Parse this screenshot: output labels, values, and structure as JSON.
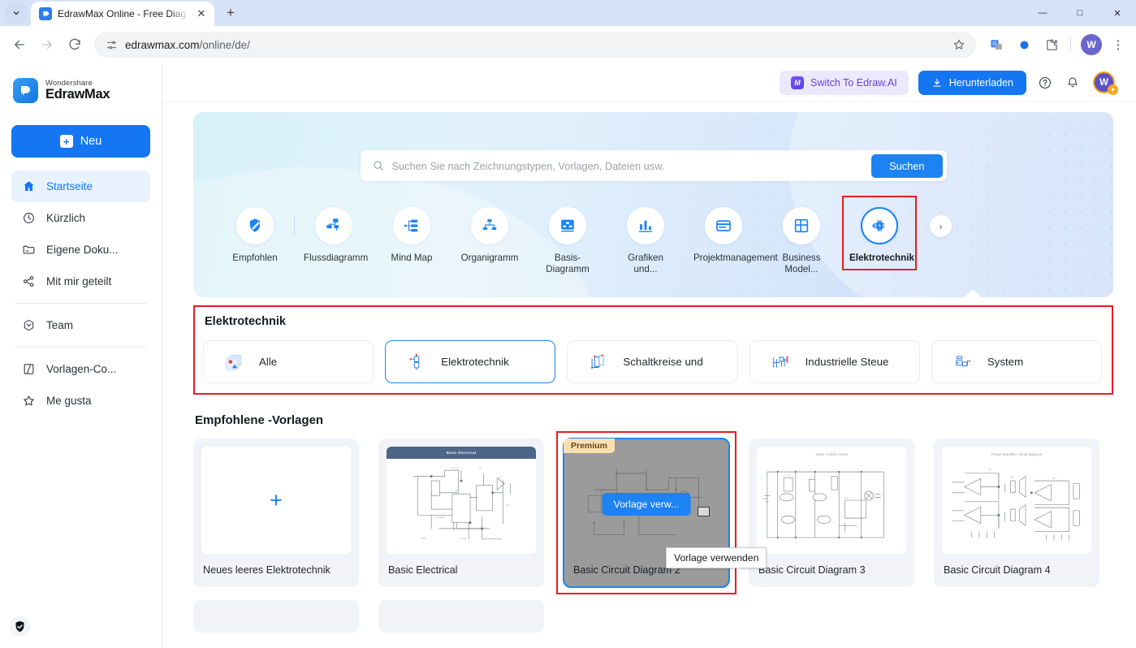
{
  "browser": {
    "tab_title": "EdrawMax Online - Free Diag",
    "new_tab_label": "+",
    "url_main": "edrawmax.com",
    "url_path": "/online/de/",
    "profile_initial": "W",
    "win_minimize": "—",
    "win_maximize": "□",
    "win_close": "✕"
  },
  "sidebar": {
    "brand_top": "Wondershare",
    "brand_bottom": "EdrawMax",
    "new_button": "Neu",
    "items": [
      {
        "label": "Startseite",
        "icon": "home-icon",
        "active": true
      },
      {
        "label": "Kürzlich",
        "icon": "clock-icon",
        "active": false
      },
      {
        "label": "Eigene Doku...",
        "icon": "folder-icon",
        "active": false
      },
      {
        "label": "Mit mir geteilt",
        "icon": "share-icon",
        "active": false
      },
      {
        "label": "Team",
        "icon": "team-icon",
        "active": false
      },
      {
        "label": "Vorlagen-Co...",
        "icon": "template-icon",
        "active": false
      },
      {
        "label": "Me gusta",
        "icon": "star-icon",
        "active": false
      }
    ]
  },
  "topbar": {
    "switch_ai": "Switch To Edraw.AI",
    "download": "Herunterladen",
    "help_icon": "question-circle-icon",
    "bell_icon": "bell-icon",
    "avatar_initial": "W"
  },
  "hero": {
    "search_placeholder": "Suchen Sie nach Zeichnungstypen, Vorlagen, Dateien usw.",
    "search_value": "",
    "search_button": "Suchen",
    "next_arrow": "›",
    "categories": [
      {
        "label": "Empfohlen",
        "icon": "recommended-icon",
        "active": false
      },
      {
        "label": "Flussdiagramm",
        "icon": "flowchart-icon",
        "active": false
      },
      {
        "label": "Mind Map",
        "icon": "mindmap-icon",
        "active": false
      },
      {
        "label": "Organigramm",
        "icon": "orgchart-icon",
        "active": false
      },
      {
        "label": "Basis-Diagramm",
        "icon": "basic-diagram-icon",
        "active": false
      },
      {
        "label": "Grafiken und...",
        "icon": "charts-icon",
        "active": false
      },
      {
        "label": "Projektmanagement",
        "icon": "project-icon",
        "active": false
      },
      {
        "label": "Business Model...",
        "icon": "business-icon",
        "active": false
      },
      {
        "label": "Elektrotechnik",
        "icon": "electrical-icon",
        "active": true
      }
    ]
  },
  "subcategory": {
    "title": "Elektrotechnik",
    "items": [
      {
        "label": "Alle",
        "icon": "all-shapes-icon",
        "active": false
      },
      {
        "label": "Elektrotechnik",
        "icon": "electrical-shape-icon",
        "active": true
      },
      {
        "label": "Schaltkreise und",
        "icon": "circuits-icon",
        "active": false
      },
      {
        "label": "Industrielle Steue",
        "icon": "industrial-control-icon",
        "active": false
      },
      {
        "label": "System",
        "icon": "system-icon",
        "active": false
      }
    ]
  },
  "templates": {
    "title": "Empfohlene -Vorlagen",
    "blank_label": "Neues leeres Elektrotechnik",
    "blank_plus": "+",
    "premium_badge": "Premium",
    "use_button": "Vorlage verw...",
    "tooltip": "Vorlage verwenden",
    "items": [
      {
        "name": "Basic Electrical",
        "thumb_title": "Basic Electrical",
        "premium": false,
        "selected": false
      },
      {
        "name": "Basic Circuit Diagram 2",
        "thumb_title": "",
        "premium": true,
        "selected": true
      },
      {
        "name": "Basic Circuit Diagram 3",
        "thumb_title": "Voice control circuit",
        "premium": false,
        "selected": false
      },
      {
        "name": "Basic Circuit Diagram 4",
        "thumb_title": "Power amplifier circuit diagram",
        "premium": false,
        "selected": false
      }
    ]
  },
  "colors": {
    "accent_blue": "#1476f2",
    "highlight_red": "#ea1c24",
    "premium_gold": "#fadfb0",
    "ai_purple": "#6a40e0"
  }
}
